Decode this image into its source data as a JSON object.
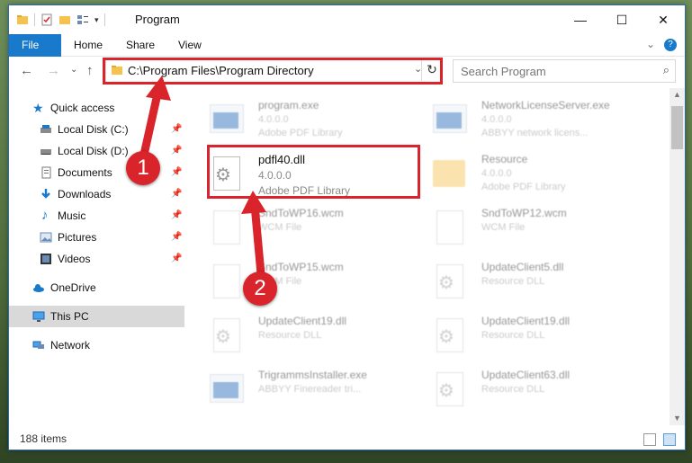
{
  "window": {
    "title": "Program",
    "controls": {
      "minimize": "—",
      "maximize": "☐",
      "close": "✕"
    }
  },
  "ribbon": {
    "tabs": [
      "File",
      "Home",
      "Share",
      "View"
    ],
    "help": "?",
    "expand": "⌄"
  },
  "navbar": {
    "back": "←",
    "forward": "→",
    "recent": "⌄",
    "up": "↑",
    "address": "C:\\Program Files\\Program Directory",
    "dropdown": "⌄",
    "refresh": "↻",
    "search_placeholder": "Search Program",
    "search_icon": "⌕"
  },
  "sidebar": {
    "items": [
      {
        "label": "Quick access",
        "icon": "star-icon",
        "pinned": false
      },
      {
        "label": "Local Disk (C:)",
        "icon": "drive-icon",
        "pinned": true
      },
      {
        "label": "Local Disk (D:)",
        "icon": "drive-icon",
        "pinned": true
      },
      {
        "label": "Documents",
        "icon": "documents-icon",
        "pinned": true
      },
      {
        "label": "Downloads",
        "icon": "downloads-icon",
        "pinned": true
      },
      {
        "label": "Music",
        "icon": "music-icon",
        "pinned": true
      },
      {
        "label": "Pictures",
        "icon": "pictures-icon",
        "pinned": true
      },
      {
        "label": "Videos",
        "icon": "videos-icon",
        "pinned": true
      },
      {
        "label": "OneDrive",
        "icon": "cloud-icon",
        "pinned": false
      },
      {
        "label": "This PC",
        "icon": "computer-icon",
        "pinned": false
      },
      {
        "label": "Network",
        "icon": "network-icon",
        "pinned": false
      }
    ],
    "pin_glyph": "📌"
  },
  "files": [
    {
      "name": "program.exe",
      "version": "4.0.0.0",
      "desc": "Adobe PDF Library",
      "kind": "exe",
      "faded": true
    },
    {
      "name": "NetworkLicenseServer.exe",
      "version": "4.0.0.0",
      "desc": "ABBYY network licens...",
      "kind": "exe",
      "faded": true
    },
    {
      "name": "pdfl40.dll",
      "version": "4.0.0.0",
      "desc": "Adobe PDF Library",
      "kind": "dll",
      "faded": false
    },
    {
      "name": "Resource",
      "version": "4.0.0.0",
      "desc": "Adobe PDF Library",
      "kind": "folder",
      "faded": true
    },
    {
      "name": "SndToWP16.wcm",
      "version": "",
      "desc": "WCM File",
      "kind": "doc",
      "faded": true
    },
    {
      "name": "SndToWP12.wcm",
      "version": "",
      "desc": "WCM File",
      "kind": "doc",
      "faded": true
    },
    {
      "name": "SndToWP15.wcm",
      "version": "",
      "desc": "WCM File",
      "kind": "doc",
      "faded": true
    },
    {
      "name": "UpdateClient5.dll",
      "version": "",
      "desc": "Resource DLL",
      "kind": "dll",
      "faded": true
    },
    {
      "name": "UpdateClient19.dll",
      "version": "",
      "desc": "Resource DLL",
      "kind": "dll",
      "faded": true
    },
    {
      "name": "UpdateClient19.dll",
      "version": "",
      "desc": "Resource DLL",
      "kind": "dll",
      "faded": true
    },
    {
      "name": "TrigrammsInstaller.exe",
      "version": "",
      "desc": "ABBYY Finereader tri...",
      "kind": "exe",
      "faded": true
    },
    {
      "name": "UpdateClient63.dll",
      "version": "",
      "desc": "Resource DLL",
      "kind": "dll",
      "faded": true
    }
  ],
  "status": {
    "item_count": "188 items"
  },
  "callouts": [
    {
      "number": "1"
    },
    {
      "number": "2"
    }
  ],
  "colors": {
    "accent": "#1979ca",
    "highlight": "#d8242a",
    "selected": "#d9d9d9"
  }
}
